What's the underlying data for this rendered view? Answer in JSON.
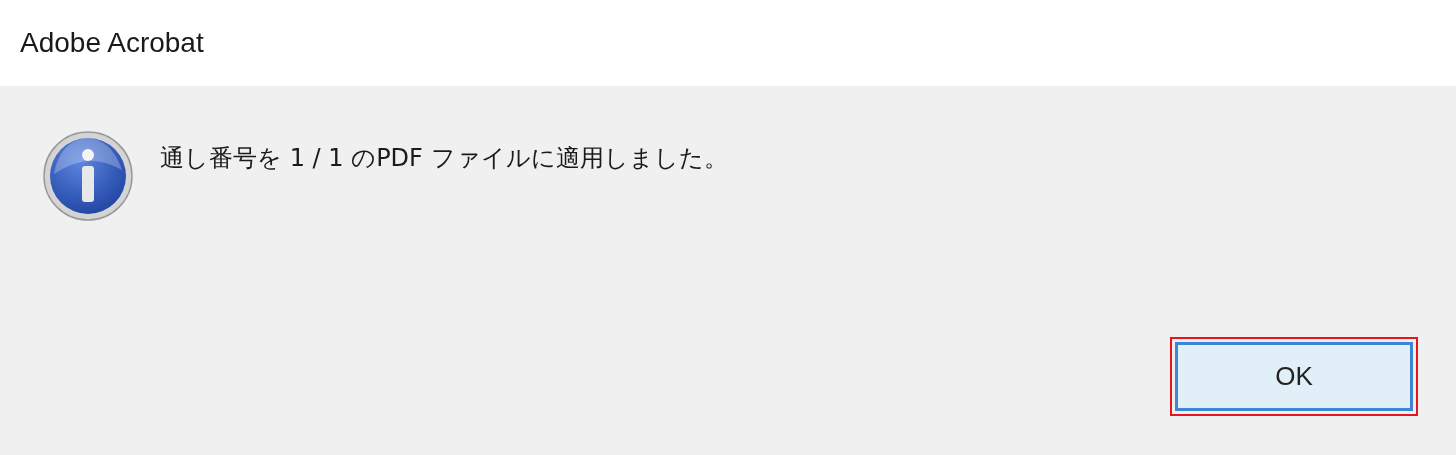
{
  "window": {
    "title": "Adobe Acrobat"
  },
  "message": "通し番号を 1 / 1 のPDF ファイルに適用しました。",
  "buttons": [
    {
      "label": "OK",
      "highlighted": true
    }
  ]
}
